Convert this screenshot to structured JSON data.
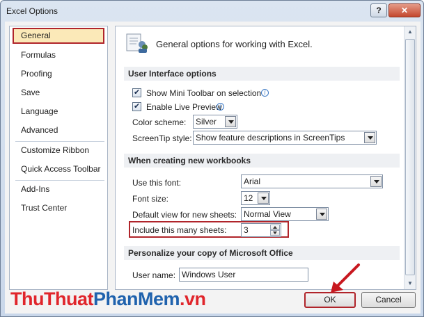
{
  "window": {
    "title": "Excel Options",
    "help_label": "?",
    "close_label": "✕"
  },
  "nav": {
    "items": [
      {
        "label": "General",
        "selected": true
      },
      {
        "label": "Formulas"
      },
      {
        "label": "Proofing"
      },
      {
        "label": "Save"
      },
      {
        "label": "Language"
      },
      {
        "label": "Advanced"
      },
      {
        "label": "Customize Ribbon"
      },
      {
        "label": "Quick Access Toolbar"
      },
      {
        "label": "Add-Ins"
      },
      {
        "label": "Trust Center"
      }
    ]
  },
  "content": {
    "header": "General options for working with Excel.",
    "ui_options": {
      "title": "User Interface options",
      "mini_toolbar": "Show Mini Toolbar on selection",
      "live_preview": "Enable Live Preview",
      "color_scheme_label": "Color scheme:",
      "color_scheme_value": "Silver",
      "screentip_label": "ScreenTip style:",
      "screentip_value": "Show feature descriptions in ScreenTips"
    },
    "new_workbooks": {
      "title": "When creating new workbooks",
      "font_label": "Use this font:",
      "font_value": "Arial",
      "font_size_label": "Font size:",
      "font_size_value": "12",
      "default_view_label": "Default view for new sheets:",
      "default_view_value": "Normal View",
      "sheets_label": "Include this many sheets:",
      "sheets_value": "3"
    },
    "personalize": {
      "title": "Personalize your copy of Microsoft Office",
      "user_name_label": "User name:",
      "user_name_value": "Windows User"
    }
  },
  "buttons": {
    "ok": "OK",
    "cancel": "Cancel"
  },
  "watermark": {
    "part1": "ThuThuat",
    "part2": "PhanMem",
    "part3": ".vn"
  },
  "colors": {
    "highlight": "#b0242a",
    "selected_bg": "#fbe9b8",
    "watermark_red": "#e0252b",
    "watermark_blue": "#1f62ad"
  }
}
